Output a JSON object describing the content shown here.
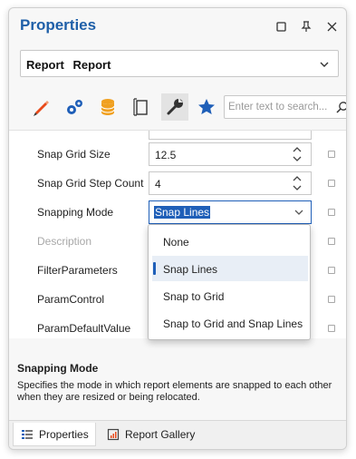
{
  "window": {
    "title": "Properties",
    "buttons": {
      "maximize": "maximize-icon",
      "pin": "pin-icon",
      "close": "close-icon"
    }
  },
  "selector": {
    "type": "Report",
    "name": "Report"
  },
  "toolbar": {
    "tabs": [
      "appearance-icon",
      "behavior-icon",
      "data-icon",
      "layout-icon",
      "tasks-icon",
      "favorites-icon"
    ],
    "active": "tasks-icon",
    "search_placeholder": "Enter text to search..."
  },
  "properties": [
    {
      "label": "Snap Grid Size",
      "value": "12.5"
    },
    {
      "label": "Snap Grid Step Count",
      "value": "4"
    },
    {
      "label": "Snapping Mode",
      "value": "Snap Lines"
    },
    {
      "label": "Description",
      "value": ""
    },
    {
      "label": "FilterParameters",
      "value": ""
    },
    {
      "label": "ParamControl",
      "value": ""
    },
    {
      "label": "ParamDefaultValue",
      "value": ""
    }
  ],
  "dropdown": {
    "options": [
      "None",
      "Snap Lines",
      "Snap to Grid",
      "Snap to Grid and Snap Lines"
    ],
    "selected": "Snap Lines"
  },
  "description": {
    "title": "Snapping Mode",
    "text": "Specifies the mode in which report elements are snapped to each other when they are resized or being relocated."
  },
  "bottom_tabs": [
    {
      "label": "Properties",
      "active": true
    },
    {
      "label": "Report Gallery",
      "active": false
    }
  ],
  "colors": {
    "title": "#1e5fa8",
    "accent": "#1f5fb8",
    "pencil": "#e84a1a",
    "gear": "#1f5fb8",
    "db": "#f0a020"
  }
}
